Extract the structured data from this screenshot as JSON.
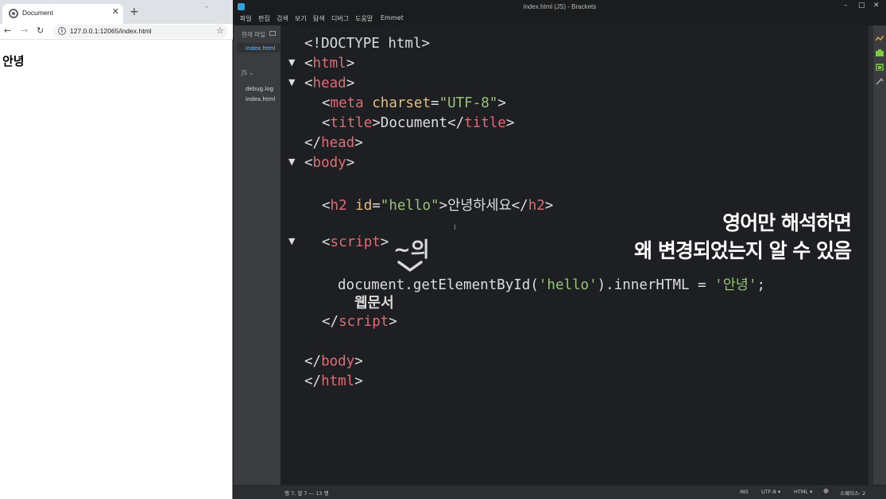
{
  "browser": {
    "tab_title": "Document",
    "url": "127.0.0.1:12065/index.html",
    "page_heading": "안녕"
  },
  "brackets": {
    "window_title": "index.html (JS) - Brackets",
    "menu": [
      "파일",
      "편집",
      "검색",
      "보기",
      "탐색",
      "디버그",
      "도움말",
      "Emmet"
    ],
    "sidebar": {
      "working_files_label": "현재 파일",
      "active_file": "index.html",
      "project_label": "JS",
      "project_files": [
        "debug.log",
        "index.html"
      ]
    },
    "code": {
      "doctype": "<!DOCTYPE html>",
      "l2_tag": "html",
      "l3_tag": "head",
      "l4_tag": "meta",
      "l4_attr": "charset",
      "l4_val": "\"UTF-8\"",
      "l5_tag": "title",
      "l5_text": "Document",
      "l6_tag": "head",
      "l7_tag": "body",
      "l9_tag": "h2",
      "l9_attr": "id",
      "l9_val": "\"hello\"",
      "l9_text": "안녕하세요",
      "l11_tag": "script",
      "l13_code": "document.getElementById(",
      "l13_arg": "'hello'",
      "l13_code2": ").innerHTML = ",
      "l13_val": "'안녕'",
      "l13_end": ";",
      "l14_tag": "script",
      "l16_tag": "body",
      "l17_tag": "html"
    },
    "overlay": {
      "line1": "영어만 해석하면",
      "line2": "왜 변경되었는지 알 수 있음"
    },
    "annotation": {
      "top": "~의",
      "bottom": "웹문서"
    },
    "status": {
      "position": "행 7, 열 7 — 13 행",
      "ins": "INS",
      "encoding": "UTF-8",
      "language": "HTML",
      "spaces": "스페이스: 2"
    },
    "colors": {
      "tag": "#e06c75",
      "attr": "#e5c07b",
      "string": "#98c379",
      "bg": "#1d1f22"
    }
  }
}
